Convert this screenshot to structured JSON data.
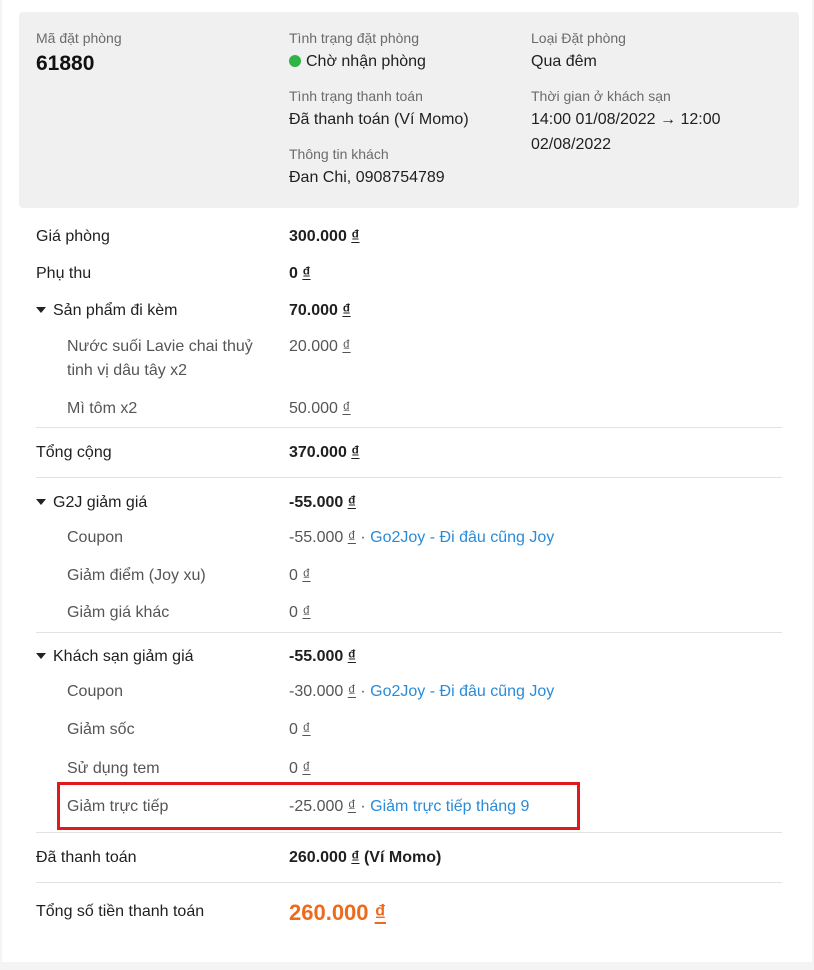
{
  "summary": {
    "booking_code_label": "Mã đặt phòng",
    "booking_code": "61880",
    "booking_status_label": "Tình trạng đặt phòng",
    "booking_status": "Chờ nhận phòng",
    "status_color": "#2fb344",
    "booking_type_label": "Loại Đặt phòng",
    "booking_type": "Qua đêm",
    "payment_status_label": "Tình trạng thanh toán",
    "payment_status": "Đã thanh toán (Ví Momo)",
    "stay_time_label": "Thời gian ở khách sạn",
    "stay_time_line1": "14:00 01/08/2022 → 12:00",
    "stay_time_line2": "02/08/2022",
    "guest_info_label": "Thông tin khách",
    "guest_info": "Đan Chi, 0908754789"
  },
  "currency": "₫",
  "rows": {
    "room_price": {
      "label": "Giá phòng",
      "value": "300.000"
    },
    "surcharge": {
      "label": "Phụ thu",
      "value": "0"
    },
    "products": {
      "label": "Sản phẩm đi kèm",
      "value": "70.000",
      "items": [
        {
          "label_line1": "Nước suối Lavie chai thuỷ",
          "label_line2": "tinh vị dâu tây x2",
          "value": "20.000"
        },
        {
          "label": "Mì tôm x2",
          "value": "50.000"
        }
      ]
    },
    "total": {
      "label": "Tổng cộng",
      "value": "370.000"
    },
    "g2j_discount": {
      "label": "G2J giảm giá",
      "value": "-55.000",
      "items": [
        {
          "label": "Coupon",
          "value": "-55.000",
          "note": "Go2Joy - Đi đâu cũng Joy"
        },
        {
          "label": "Giảm điểm (Joy xu)",
          "value": "0"
        },
        {
          "label": "Giảm giá khác",
          "value": "0"
        }
      ]
    },
    "hotel_discount": {
      "label": "Khách sạn giảm giá",
      "value": "-55.000",
      "items": [
        {
          "label": "Coupon",
          "value": "-30.000",
          "note": "Go2Joy - Đi đâu cũng Joy"
        },
        {
          "label": "Giảm sốc",
          "value": "0"
        },
        {
          "label": "Sử dụng tem",
          "value": "0"
        },
        {
          "label": "Giảm trực tiếp",
          "value": "-25.000",
          "note": "Giảm trực tiếp tháng 9"
        }
      ]
    },
    "paid": {
      "label": "Đã thanh toán",
      "value": "260.000",
      "suffix": "(Ví Momo)"
    },
    "grand_total": {
      "label": "Tổng số tiền thanh toán",
      "value": "260.000"
    }
  },
  "separator": " · ",
  "colors": {
    "accent": "#ee6a1c",
    "link": "#2a8bd8",
    "highlight_border": "#e0191c"
  }
}
